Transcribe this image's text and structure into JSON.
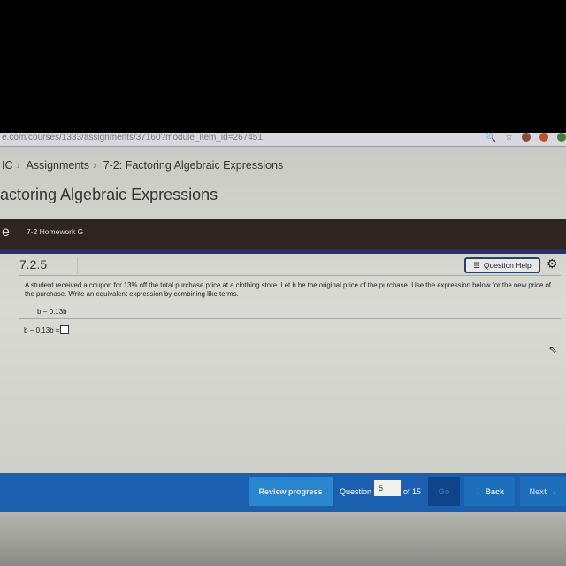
{
  "browser": {
    "url": "e.com/courses/1333/assignments/37160?module_item_id=267451"
  },
  "breadcrumb": {
    "items": [
      "IC",
      "Assignments",
      "7-2: Factoring Algebraic Expressions"
    ]
  },
  "page_title": "actoring Algebraic Expressions",
  "band": {
    "left_letter": "e",
    "homework": "7-2 Homework G"
  },
  "question": {
    "number": "7.2.5",
    "help_label": "Question Help",
    "text": "A student received a coupon for 13% off the total purchase price at a clothing store. Let b be the original price of the purchase. Use the expression below for the new price of the purchase. Write an equivalent expression by combining like terms.",
    "expression": "b − 0.13b",
    "answer_prompt": "b − 0.13b ="
  },
  "footer": {
    "review_label": "Review progress",
    "question_label": "Question",
    "question_value": "5",
    "of_label": "of 15",
    "go_label": "Go",
    "back_label": "← Back",
    "next_label": "Next →"
  },
  "colors": {
    "footer": "#1b5fb0",
    "review": "#2a86cf",
    "band": "#2e2522"
  }
}
